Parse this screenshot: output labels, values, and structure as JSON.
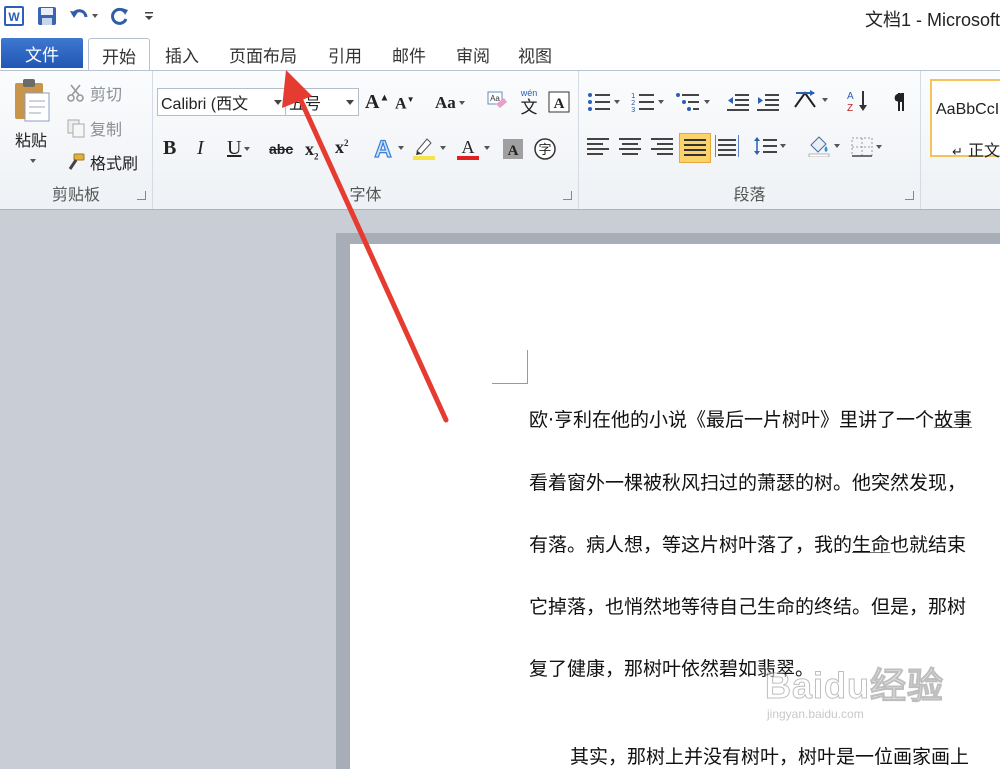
{
  "window": {
    "title": "文档1 - Microsoft"
  },
  "tabs": {
    "file": "文件",
    "items": [
      "开始",
      "插入",
      "页面布局",
      "引用",
      "邮件",
      "审阅",
      "视图"
    ]
  },
  "clipboard": {
    "paste": "粘贴",
    "cut": "剪切",
    "copy": "复制",
    "format_painter": "格式刷",
    "group_label": "剪贴板"
  },
  "font": {
    "font_name": "Calibri (西文",
    "font_size": "五号",
    "group_label": "字体",
    "case_btn": "Aa",
    "strike": "abc"
  },
  "paragraph": {
    "group_label": "段落"
  },
  "styles": {
    "sample": "AaBbCcI",
    "name": "正文"
  },
  "document": {
    "lines": [
      {
        "text": "欧·亨利在他的小说《最后一片树叶》里讲了一个",
        "ul": "故事"
      },
      {
        "text": "看着窗外一棵被秋风扫过的萧瑟的树。他突然发现，",
        "ul": ""
      },
      {
        "text": "有落。病人想，等这片树叶落了，我的",
        "ul": "生命",
        "tail": "也就结束"
      },
      {
        "text": "它掉落，也悄然地等待自己生命的终结。但是，那树",
        "ul": ""
      },
      {
        "text": "复了健康，那树叶依然碧如翡翠。",
        "ul": ""
      },
      {
        "text": "其实，那树上并没有树叶，树叶是一位画家画上",
        "ul": ""
      }
    ]
  },
  "watermark": {
    "brand": "Baidu经验",
    "url": "jingyan.baidu.com"
  },
  "colors": {
    "file_tab": "#2b63c0",
    "arrow": "#e53b30",
    "highlight": "#f7e24a",
    "font_color": "#e02020"
  }
}
